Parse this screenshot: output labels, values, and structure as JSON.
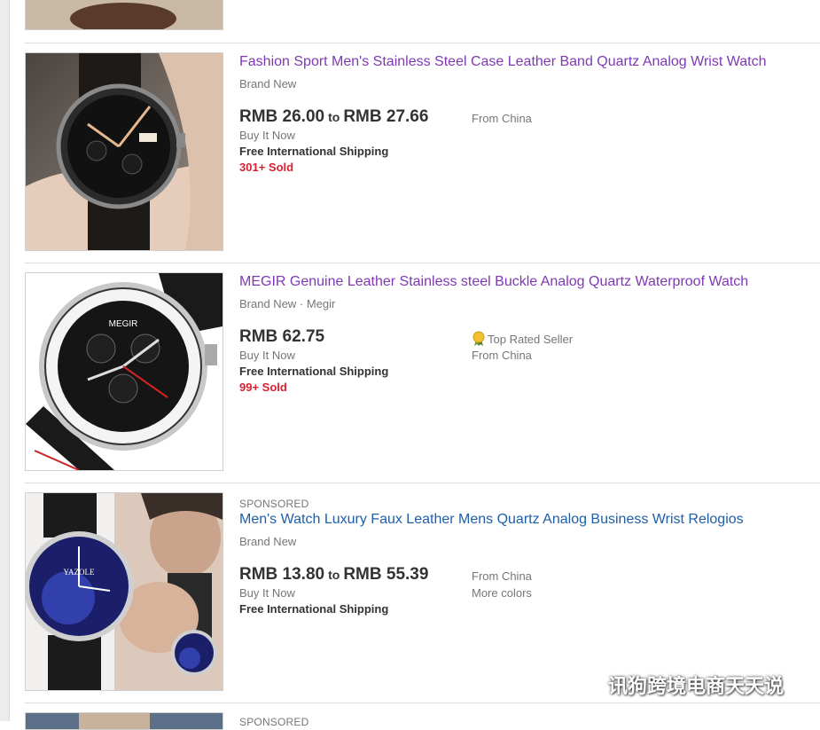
{
  "listings": [
    {
      "title": "Fashion Sport Men's Stainless Steel Case Leather Band Quartz Analog Wrist Watch",
      "subtitle": "Brand New",
      "price_low": "RMB 26.00",
      "price_to": "to",
      "price_high": "RMB 27.66",
      "buy_format": "Buy It Now",
      "shipping": "Free International Shipping",
      "sold": "301+ Sold",
      "location": "From China"
    },
    {
      "title": "MEGIR Genuine Leather Stainless steel Buckle Analog Quartz Waterproof Watch",
      "subtitle": "Brand New · Megir",
      "price": "RMB 62.75",
      "buy_format": "Buy It Now",
      "shipping": "Free International Shipping",
      "sold": "99+ Sold",
      "seller_badge": "Top Rated Seller",
      "location": "From China",
      "watch_brand": "MEGIR"
    },
    {
      "sponsored": "SPONSORED",
      "title": "Men's Watch Luxury Faux Leather Mens Quartz Analog Business Wrist Relogios",
      "subtitle": "Brand New",
      "price_low": "RMB 13.80",
      "price_to": "to",
      "price_high": "RMB 55.39",
      "buy_format": "Buy It Now",
      "shipping": "Free International Shipping",
      "location": "From China",
      "more": "More colors",
      "watch_brand": "YAZOLE"
    },
    {
      "sponsored": "SPONSORED"
    }
  ],
  "watermark": "讯狗跨境电商天天说",
  "colors": {
    "visited_link": "#7f38b5",
    "link": "#1f5ea8",
    "sold": "#dd1e31",
    "muted": "#767676",
    "separator": "#dddddd"
  }
}
